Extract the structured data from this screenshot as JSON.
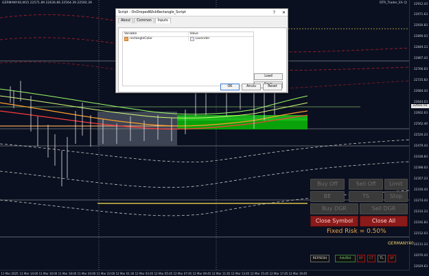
{
  "chart": {
    "symbol_line": "GERMANY40,M15  22571.89 22636.86 22564.39 22592.39",
    "indicator_line": "DTR_Trader_EA ☺",
    "price_box": "22602.91",
    "price_axis_labels": [
      "22912.43",
      "22971.63",
      "22930.83",
      "22890.03",
      "22849.23",
      "22807.43",
      "22766.63",
      "22725.83",
      "22684.43",
      "22644.03",
      "22602.63",
      "22562.40",
      "22520.23",
      "22479.43",
      "22438.83",
      "22398.03",
      "22357.23",
      "22316.43",
      "22274.43",
      "22233.23",
      "22192.83",
      "22152.03",
      "22111.23",
      "22070.43",
      "22029.63"
    ],
    "time_axis_labels": [
      "11 Mar 2025",
      "11 Mar 14:00",
      "11 Mar 16:00",
      "11 Mar 18:00",
      "11 Mar 20:00",
      "11 Mar 22:00",
      "12 Mar 01:30",
      "12 Mar 03:45",
      "12 Mar 05:45",
      "12 Mar 07:45",
      "12 Mar 09:45",
      "12 Mar 11:45",
      "12 Mar 13:45",
      "12 Mar 15:45",
      "12 Mar 17:45",
      "12 Mar 19:45"
    ]
  },
  "dialog": {
    "title": "Script - OnDropedWickRectangle_Script",
    "help": "?",
    "close": "✕",
    "tabs": [
      "About",
      "Common",
      "Inputs"
    ],
    "table": {
      "headers": [
        "Variable",
        "Value"
      ],
      "row": {
        "variable": "rectangleColor",
        "value": "Lavender"
      }
    },
    "buttons": {
      "load": "Load",
      "save": "Save",
      "ok": "OK",
      "cancel": "Anulu",
      "reset": "Reset"
    }
  },
  "trade_panel": {
    "buy_off": "Buy Off",
    "sell_off": "Sell Off",
    "limit": "Limit",
    "be": "BE",
    "ts": "TS",
    "stop": "Stop",
    "buy_dgr": "Buy DGR",
    "sell_dgr": "Sell DGR",
    "close_symbol": "Close Symbol",
    "close_all": "Close All",
    "fixed_risk": "Fixed Risk = 0.50%",
    "symbol": "GERMANY40",
    "bottom": {
      "refresh": "REFRESH",
      "ask_bid": "Ask/Bid",
      "ep": "EP",
      "ct": "CT",
      "tl": "TL",
      "sp": "SP"
    }
  }
}
